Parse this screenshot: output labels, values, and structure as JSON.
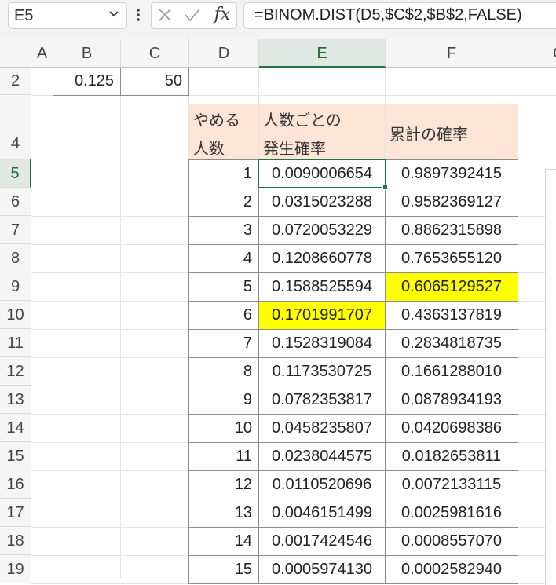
{
  "formula_bar": {
    "name_box": "E5",
    "formula": "=BINOM.DIST(D5,$C$2,$B$2,FALSE)",
    "fx_label": "fx"
  },
  "columns": [
    "A",
    "B",
    "C",
    "D",
    "E",
    "F",
    "G"
  ],
  "selected_cell": "E5",
  "colors": {
    "highlight": "#ffff00",
    "header_fill": "#fce4d6",
    "selection": "#217346"
  },
  "cells": {
    "b2": "0.125",
    "c2": "50",
    "header": {
      "d_line1": "やめる",
      "d_line2": "人数",
      "e_line1": "人数ごとの",
      "e_line2": "発生確率",
      "f": "累計の確率"
    }
  },
  "row_numbers": {
    "r1": "",
    "r2": "2",
    "r4": "4"
  },
  "rows": [
    {
      "row": "5",
      "d": "1",
      "e": "0.0090006654",
      "f": "0.9897392415"
    },
    {
      "row": "6",
      "d": "2",
      "e": "0.0315023288",
      "f": "0.9582369127"
    },
    {
      "row": "7",
      "d": "3",
      "e": "0.0720053229",
      "f": "0.8862315898"
    },
    {
      "row": "8",
      "d": "4",
      "e": "0.1208660778",
      "f": "0.7653655120"
    },
    {
      "row": "9",
      "d": "5",
      "e": "0.1588525594",
      "f": "0.6065129527"
    },
    {
      "row": "10",
      "d": "6",
      "e": "0.1701991707",
      "f": "0.4363137819"
    },
    {
      "row": "11",
      "d": "7",
      "e": "0.1528319084",
      "f": "0.2834818735"
    },
    {
      "row": "12",
      "d": "8",
      "e": "0.1173530725",
      "f": "0.1661288010"
    },
    {
      "row": "13",
      "d": "9",
      "e": "0.0782353817",
      "f": "0.0878934193"
    },
    {
      "row": "14",
      "d": "10",
      "e": "0.0458235807",
      "f": "0.0420698386"
    },
    {
      "row": "15",
      "d": "11",
      "e": "0.0238044575",
      "f": "0.0182653811"
    },
    {
      "row": "16",
      "d": "12",
      "e": "0.0110520696",
      "f": "0.0072133115"
    },
    {
      "row": "17",
      "d": "13",
      "e": "0.0046151499",
      "f": "0.0025981616"
    },
    {
      "row": "18",
      "d": "14",
      "e": "0.0017424546",
      "f": "0.0008557070"
    },
    {
      "row": "19",
      "d": "15",
      "e": "0.0005974130",
      "f": "0.0002582940"
    }
  ]
}
